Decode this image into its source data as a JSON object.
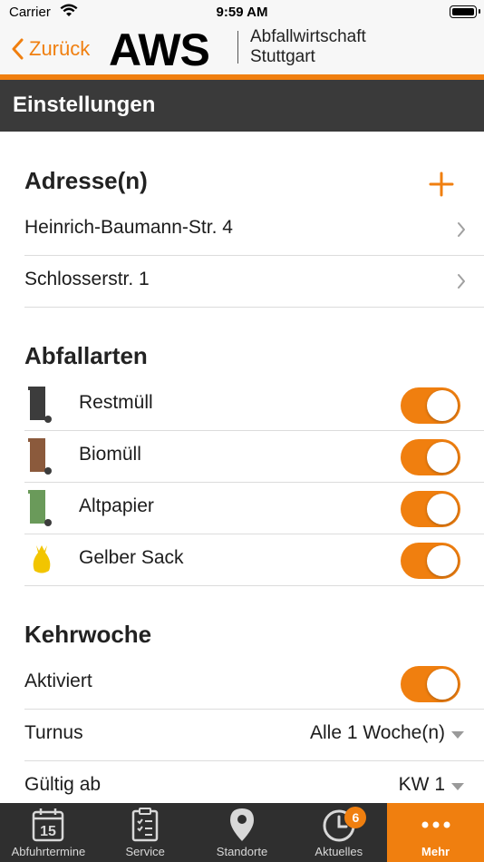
{
  "status_bar": {
    "carrier": "Carrier",
    "time": "9:59 AM"
  },
  "nav": {
    "back_label": "Zurück",
    "logo_text": "AWS",
    "logo_subtitle_line1": "Abfallwirtschaft",
    "logo_subtitle_line2": "Stuttgart"
  },
  "page_title": "Einstellungen",
  "addresses": {
    "heading": "Adresse(n)",
    "items": [
      {
        "label": "Heinrich-Baumann-Str. 4"
      },
      {
        "label": "Schlosserstr. 1"
      }
    ]
  },
  "waste_types": {
    "heading": "Abfallarten",
    "items": [
      {
        "label": "Restmüll",
        "icon": "restmuell-bin-icon",
        "color": "#3c3c3c",
        "enabled": true
      },
      {
        "label": "Biomüll",
        "icon": "biomuell-bin-icon",
        "color": "#8b5a3c",
        "enabled": true
      },
      {
        "label": "Altpapier",
        "icon": "altpapier-bin-icon",
        "color": "#6a9a5a",
        "enabled": true
      },
      {
        "label": "Gelber Sack",
        "icon": "gelber-sack-icon",
        "color": "#f2c500",
        "enabled": true
      }
    ]
  },
  "kehrwoche": {
    "heading": "Kehrwoche",
    "activated_label": "Aktiviert",
    "activated": true,
    "turnus_label": "Turnus",
    "turnus_value": "Alle 1 Woche(n)",
    "valid_from_label": "Gültig ab",
    "valid_from_value": "KW 1"
  },
  "tab_bar": {
    "tabs": [
      {
        "label": "Abfuhrtermine",
        "icon": "calendar-icon",
        "icon_text": "15"
      },
      {
        "label": "Service",
        "icon": "clipboard-icon"
      },
      {
        "label": "Standorte",
        "icon": "map-pin-icon"
      },
      {
        "label": "Aktuelles",
        "icon": "clock-icon",
        "badge": "6"
      },
      {
        "label": "Mehr",
        "icon": "more-dots-icon",
        "active": true
      }
    ]
  },
  "colors": {
    "accent": "#f07f0f",
    "title_bar": "#3a3a3a",
    "tab_bar": "#2f2f2f"
  }
}
